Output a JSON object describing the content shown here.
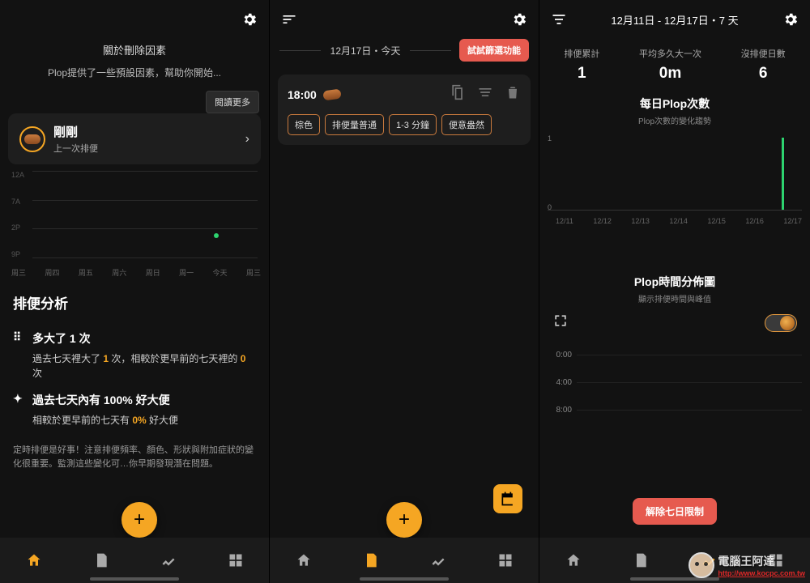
{
  "screen1": {
    "intro_title": "關於刪除因素",
    "intro_desc": "Plop提供了一些預設因素，幫助你開始...",
    "read_more": "閱讀更多",
    "card": {
      "title": "剛剛",
      "sub": "上一次排便"
    },
    "y_labels": [
      "12A",
      "7A",
      "2P",
      "9P"
    ],
    "x_labels": [
      "周三",
      "周四",
      "周五",
      "周六",
      "周日",
      "周一",
      "今天",
      "周三"
    ],
    "section_title": "排便分析",
    "an1": {
      "head": "多大了 1 次",
      "body_a": "過去七天裡大了 ",
      "body_b": "1",
      "body_c": " 次，相較於更早前的七天裡的 ",
      "body_d": "0",
      "body_e": " 次"
    },
    "an2": {
      "head": "過去七天內有 100% 好大便",
      "body_a": "相較於更早前的七天有 ",
      "body_b": "0%",
      "body_c": " 好大便"
    },
    "footnote": "定時排便是好事！注意排便頻率、顏色、形狀與附加症狀的變化很重要。監測這些變化可…你早期發現潛在問題。"
  },
  "screen2": {
    "date_header": "12月17日・今天",
    "promo": "試試篩選功能",
    "entry": {
      "time": "18:00",
      "chips": [
        "棕色",
        "排便量普通",
        "1-3 分鐘",
        "便意盎然"
      ]
    }
  },
  "screen3": {
    "range": "12月11日 - 12月17日・7 天",
    "stats": [
      {
        "lbl": "排便累計",
        "val": "1"
      },
      {
        "lbl": "平均多久大一次",
        "val": "0m"
      },
      {
        "lbl": "沒排便日數",
        "val": "6"
      }
    ],
    "chart1": {
      "title": "每日Plop次數",
      "sub": "Plop次數的變化趨勢",
      "x": [
        "12/11",
        "12/12",
        "12/13",
        "12/14",
        "12/15",
        "12/16",
        "12/17"
      ]
    },
    "chart2": {
      "title": "Plop時間分佈圖",
      "sub": "顯示排便時間與峰值",
      "times": [
        "0:00",
        "4:00",
        "8:00"
      ]
    },
    "unlock": "解除七日限制"
  },
  "watermark": {
    "t1": "電腦王阿達",
    "t2": "http://www.kocpc.com.tw"
  },
  "chart_data": [
    {
      "type": "scatter",
      "title": "",
      "y_categories": [
        "12A",
        "7A",
        "2P",
        "9P"
      ],
      "x_categories": [
        "周三",
        "周四",
        "周五",
        "周六",
        "周日",
        "周一",
        "今天",
        "周三"
      ],
      "points": [
        {
          "x": "今天",
          "y": "2P"
        }
      ]
    },
    {
      "type": "bar",
      "title": "每日Plop次數",
      "categories": [
        "12/11",
        "12/12",
        "12/13",
        "12/14",
        "12/15",
        "12/16",
        "12/17"
      ],
      "values": [
        0,
        0,
        0,
        0,
        0,
        0,
        1
      ],
      "ylim": [
        0,
        1
      ]
    },
    {
      "type": "bar",
      "title": "Plop時間分佈圖",
      "categories": [
        "0:00",
        "4:00",
        "8:00"
      ],
      "values": [
        0,
        0,
        0
      ]
    }
  ]
}
